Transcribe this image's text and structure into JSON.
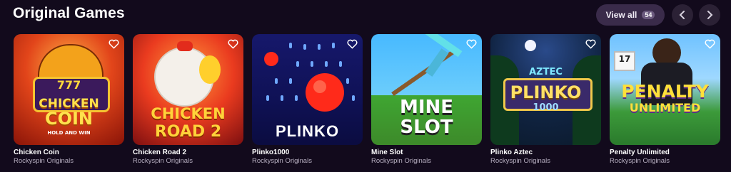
{
  "section": {
    "title": "Original Games",
    "view_all_label": "View all",
    "view_all_count": "54"
  },
  "nav": {
    "prev_icon": "chevron-left-icon",
    "next_icon": "chevron-right-icon"
  },
  "games": [
    {
      "name": "Chicken Coin",
      "provider": "Rockyspin Originals",
      "art_lines": [
        "777",
        "CHICKEN",
        "COIN",
        "HOLD AND WIN"
      ]
    },
    {
      "name": "Chicken Road 2",
      "provider": "Rockyspin Originals",
      "art_lines": [
        "CHICKEN",
        "ROAD 2"
      ]
    },
    {
      "name": "Plinko1000",
      "provider": "Rockyspin Originals",
      "art_lines": [
        "PLINKO"
      ]
    },
    {
      "name": "Mine Slot",
      "provider": "Rockyspin Originals",
      "art_lines": [
        "MINE",
        "SLOT"
      ]
    },
    {
      "name": "Plinko Aztec",
      "provider": "Rockyspin Originals",
      "art_lines": [
        "AZTEC",
        "PLINKO",
        "1000"
      ]
    },
    {
      "name": "Penalty Unlimited",
      "provider": "Rockyspin Originals",
      "art_lines": [
        "17",
        "PENALTY",
        "UNLIMITED"
      ]
    }
  ],
  "colors": {
    "background": "#120a1c",
    "view_all_bg": "#3a2b4a",
    "nav_bg": "#2b2135",
    "provider_text": "#b8b0c2"
  }
}
